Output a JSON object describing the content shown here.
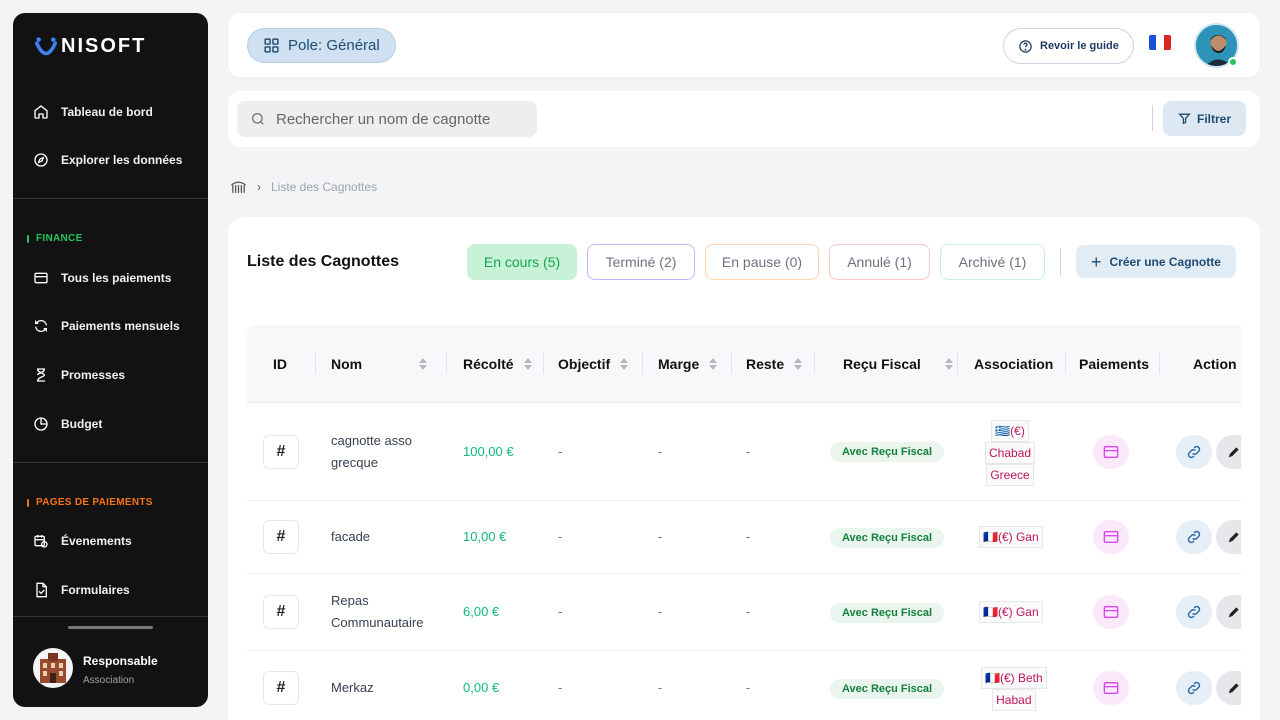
{
  "brand": {
    "name": "NISOFT"
  },
  "sidebar": {
    "nav": [
      {
        "label": "Tableau de bord",
        "icon": "home-icon"
      },
      {
        "label": "Explorer les données",
        "icon": "compass-icon"
      }
    ],
    "sections": [
      {
        "title": "FINANCE",
        "color": "#22c55e",
        "items": [
          {
            "label": "Tous les paiements",
            "icon": "credit-card-icon"
          },
          {
            "label": "Paiements mensuels",
            "icon": "refresh-icon"
          },
          {
            "label": "Promesses",
            "icon": "hourglass-icon"
          },
          {
            "label": "Budget",
            "icon": "pie-chart-icon"
          }
        ]
      },
      {
        "title": "PAGES DE PAIEMENTS",
        "color": "#f97316",
        "items": [
          {
            "label": "Évenements",
            "icon": "calendar-clock-icon"
          },
          {
            "label": "Formulaires",
            "icon": "form-icon"
          }
        ]
      }
    ],
    "profile": {
      "name": "Responsable",
      "role": "Association"
    }
  },
  "header": {
    "pole_label": "Pole: Général",
    "guide_label": "Revoir le guide"
  },
  "search": {
    "placeholder": "Rechercher un nom de cagnotte",
    "value": ""
  },
  "filter_label": "Filtrer",
  "breadcrumb": {
    "current": "Liste des Cagnottes"
  },
  "panel": {
    "title": "Liste des Cagnottes",
    "tabs": [
      {
        "label": "En cours (5)",
        "active": true,
        "color": "#22c55e",
        "bg": "#c7f2d8"
      },
      {
        "label": "Terminé (2)",
        "color": "#c4b5fd",
        "bg": "#ffffff"
      },
      {
        "label": "En pause (0)",
        "color": "#fdd5b0",
        "bg": "#ffffff"
      },
      {
        "label": "Annulé (1)",
        "color": "#fbc7c7",
        "bg": "#ffffff"
      },
      {
        "label": "Archivé (1)",
        "color": "#c6eef0",
        "bg": "#ffffff"
      }
    ],
    "create_label": "Créer une Cagnotte"
  },
  "table": {
    "headers": [
      "ID",
      "Nom",
      "Récolté",
      "Objectif",
      "Marge",
      "Reste",
      "Reçu Fiscal",
      "Association",
      "Paiements",
      "Action"
    ],
    "rows": [
      {
        "id": "#",
        "nom": "cagnotte asso grecque",
        "recolte": "100,00 €",
        "objectif": "-",
        "marge": "-",
        "reste": "-",
        "recu": "Avec Reçu Fiscal",
        "assoc_lines": [
          "🇬🇷(€)",
          "Chabad",
          "Greece"
        ]
      },
      {
        "id": "#",
        "nom": "facade",
        "recolte": "10,00 €",
        "objectif": "-",
        "marge": "-",
        "reste": "-",
        "recu": "Avec Reçu Fiscal",
        "assoc_lines": [
          "🇫🇷(€) Gan"
        ]
      },
      {
        "id": "#",
        "nom": "Repas Communautaire",
        "recolte": "6,00 €",
        "objectif": "-",
        "marge": "-",
        "reste": "-",
        "recu": "Avec Reçu Fiscal",
        "assoc_lines": [
          "🇫🇷(€) Gan"
        ]
      },
      {
        "id": "#",
        "nom": "Merkaz",
        "recolte": "0,00 €",
        "objectif": "-",
        "marge": "-",
        "reste": "-",
        "recu": "Avec Reçu Fiscal",
        "assoc_lines": [
          "🇫🇷(€) Beth",
          "Habad"
        ]
      }
    ]
  }
}
